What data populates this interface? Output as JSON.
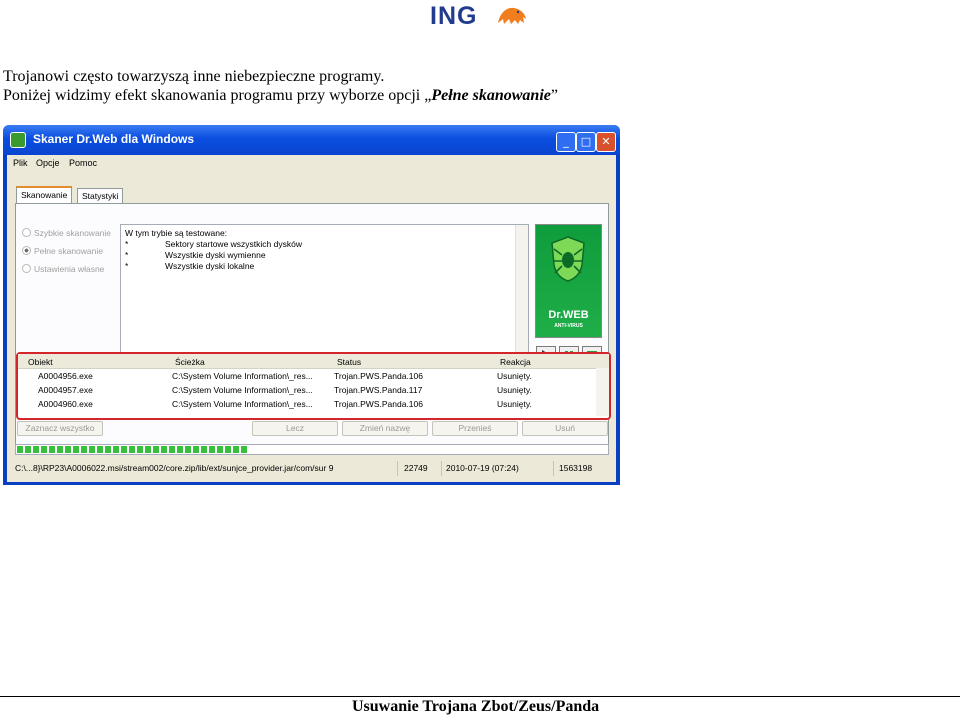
{
  "logo": {
    "text": "ING"
  },
  "intro": {
    "line1": "Trojanowi często towarzyszą inne niebezpieczne programy.",
    "line2_prefix": "Poniżej widzimy efekt skanowania programu przy wyborze opcji „",
    "line2_emphasis": "Pełne skanowanie",
    "line2_suffix": "”"
  },
  "window": {
    "title": "Skaner Dr.Web dla Windows",
    "menu": [
      "Plik",
      "Opcje",
      "Pomoc"
    ],
    "tabs": [
      "Skanowanie",
      "Statystyki"
    ],
    "scan_modes": [
      "Szybkie skanowanie",
      "Pełne skanowanie",
      "Ustawienia własne"
    ],
    "description": {
      "heading": "W tym trybie są testowane:",
      "bullet": "*",
      "items": [
        "Sektory startowe wszystkich dysków",
        "Wszystkie dyski wymienne",
        "Wszystkie dyski lokalne"
      ]
    },
    "brand": {
      "name": "Dr.WEB",
      "sub": "ANTI-VIRUS"
    },
    "results": {
      "columns": [
        "Obiekt",
        "Ścieżka",
        "Status",
        "Reakcja"
      ],
      "rows": [
        [
          "A0004956.exe",
          "C:\\System Volume Information\\_res...",
          "Trojan.PWS.Panda.106",
          "Usunięty."
        ],
        [
          "A0004957.exe",
          "C:\\System Volume Information\\_res...",
          "Trojan.PWS.Panda.117",
          "Usunięty."
        ],
        [
          "A0004960.exe",
          "C:\\System Volume Information\\_res...",
          "Trojan.PWS.Panda.106",
          "Usunięty."
        ]
      ]
    },
    "buttons": [
      "Zaznacz wszystko",
      "Lecz",
      "Zmień nazwę",
      "Przenieś",
      "Usuń"
    ],
    "progress": 0.39,
    "status": {
      "path": "C:\\...8}\\RP23\\A0006022.msi/stream002/core.zip/lib/ext/sunjce_provider.jar/com/sur 9",
      "count": "22749",
      "time": "2010-07-19 (07:24)",
      "total": "1563198"
    }
  },
  "footer": "Usuwanie Trojana Zbot/Zeus/Panda"
}
